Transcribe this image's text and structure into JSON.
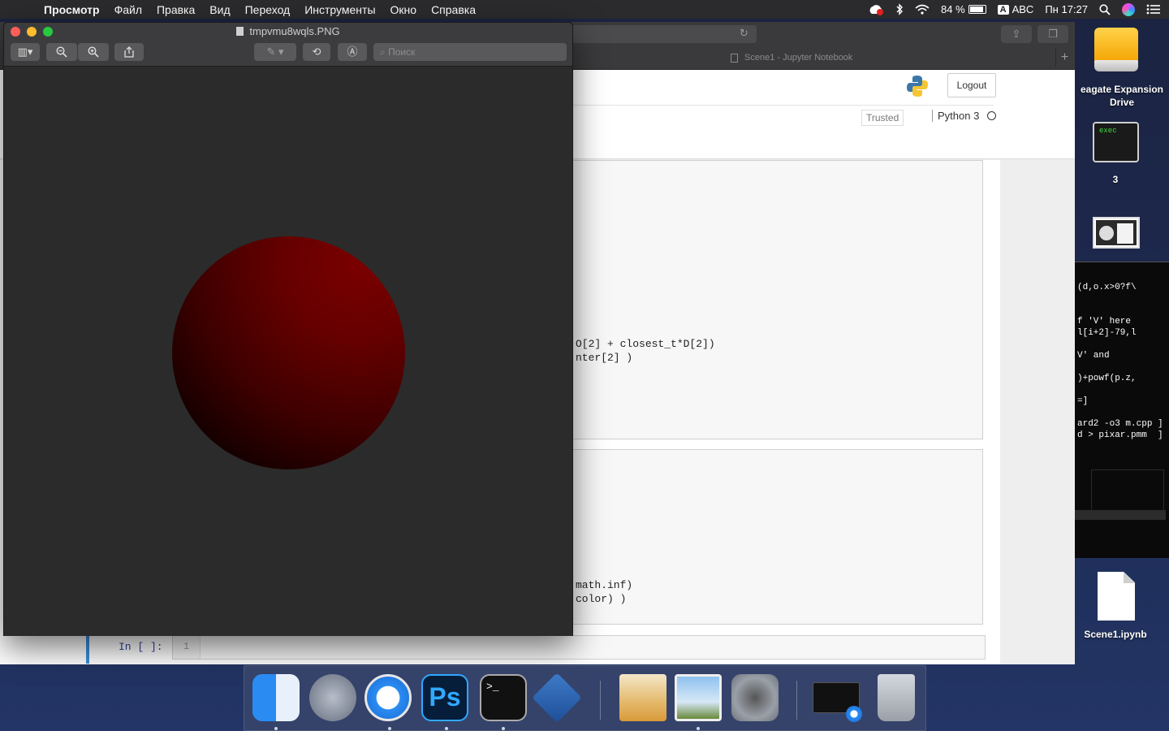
{
  "menubar": {
    "app_name": "Просмотр",
    "items": [
      "Файл",
      "Правка",
      "Вид",
      "Переход",
      "Инструменты",
      "Окно",
      "Справка"
    ],
    "battery": "84 %",
    "input_badge": "A",
    "input_source": "ABC",
    "clock": "Пн 17:27"
  },
  "preview": {
    "title": "tmpvmu8wqls.PNG",
    "search_placeholder": "Поиск",
    "image": {
      "subject": "red shaded sphere",
      "sphere_color": "#6a0000",
      "background": "#2b2b2b"
    }
  },
  "browser": {
    "tab_title": "Scene1 - Jupyter Notebook",
    "logout_label": "Logout",
    "trusted_label": "Trusted",
    "kernel_label": "Python 3",
    "cell1_lines": [
      "O[2] + closest_t*D[2])",
      "nter[2] )"
    ],
    "cell2_lines": [
      "math.inf)",
      "color) )"
    ],
    "input_prompt": "In [ ]:",
    "line_number": "1"
  },
  "desktop": {
    "drive_label": "eagate Expansion Drive",
    "exec_icon_text": "exec",
    "exec_label": "3",
    "notebook_file_label": "Scene1.ipynb"
  },
  "terminal": {
    "lines": [
      "(d,o.x>0?f\\",
      "f 'V' here",
      "l[i+2]-79,l",
      "V' and",
      ")+powf(p.z,",
      "=]",
      "ard2 -o3 m.cpp ]",
      "d > pixar.pmm  ]"
    ]
  },
  "dock": {
    "apps": [
      "finder",
      "launchpad",
      "safari",
      "photoshop",
      "terminal",
      "virtualbox",
      "documents",
      "preview",
      "system-preferences",
      "safari-window",
      "trash"
    ],
    "ps_label": "Ps",
    "terminal_glyph": ">_"
  }
}
